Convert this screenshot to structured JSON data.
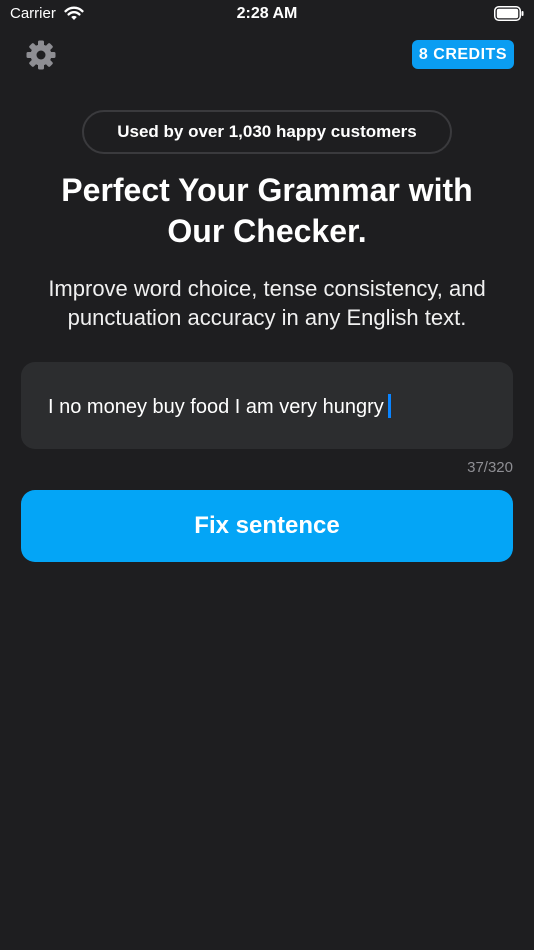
{
  "status_bar": {
    "carrier": "Carrier",
    "time": "2:28 AM",
    "wifi_icon": "wifi-icon",
    "battery_icon": "battery-icon"
  },
  "top_bar": {
    "settings_icon": "gear-icon",
    "credits_label": "8 CREDITS"
  },
  "social_proof": "Used by over 1,030 happy customers",
  "headline": {
    "line1": "Perfect Your Grammar with",
    "line2": "Our Checker."
  },
  "subheadline": {
    "line1": "Improve word choice, tense consistency, and",
    "line2": "punctuation accuracy in any English text."
  },
  "input": {
    "value": "I no money buy food I am very hungry",
    "counter": "37/320"
  },
  "primary_button": "Fix sentence",
  "colors": {
    "background": "#1e1e20",
    "accent": "#04a5f6",
    "input_background": "#2c2d2f",
    "cursor": "#0a84ff",
    "muted_text": "#8e8e93"
  }
}
